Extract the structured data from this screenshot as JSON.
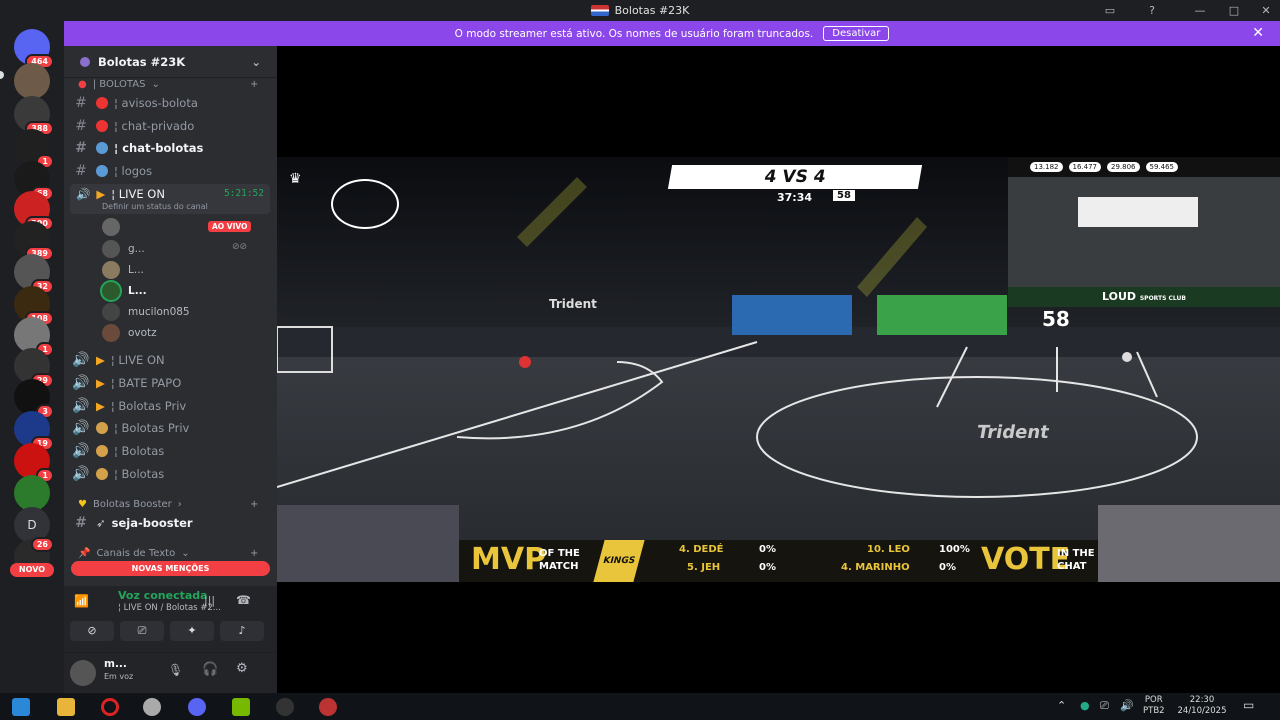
{
  "window": {
    "title": "Bolotas #23K"
  },
  "servers": [
    {
      "badge": "464"
    },
    {
      "badge": ""
    },
    {
      "badge": "388"
    },
    {
      "badge": "1"
    },
    {
      "badge": "68"
    },
    {
      "badge": "290"
    },
    {
      "badge": "389"
    },
    {
      "badge": "32"
    },
    {
      "badge": "108"
    },
    {
      "badge": "1"
    },
    {
      "badge": "29"
    },
    {
      "badge": "3"
    },
    {
      "badge": "19"
    },
    {
      "badge": "1"
    },
    {
      "badge": ""
    },
    {
      "badge": ""
    },
    {
      "badge": "26"
    }
  ],
  "server_d_label": "D",
  "novo_label": "NOVO",
  "banner": {
    "text": "O modo streamer está ativo. Os nomes de usuário foram truncados.",
    "button": "Desativar"
  },
  "guild": {
    "name": "Bolotas #23K"
  },
  "category_bolotas": "| BOLOTAS",
  "channels": [
    {
      "name": "¦ avisos-bolota"
    },
    {
      "name": "¦ chat-privado"
    },
    {
      "name": "¦ chat-bolotas"
    },
    {
      "name": "¦ logos"
    }
  ],
  "live_channel": {
    "name": "¦ LIVE ON",
    "timer": "5:21:52",
    "status": "Definir um status do canal"
  },
  "live_badge": "AO VIVO",
  "voice_users": [
    {
      "name": ""
    },
    {
      "name": "g..."
    },
    {
      "name": "L..."
    },
    {
      "name": "L..."
    },
    {
      "name": "mucilon085"
    },
    {
      "name": "ovotz"
    }
  ],
  "voice_channels": [
    {
      "name": "¦ LIVE ON"
    },
    {
      "name": "¦ BATE PAPO"
    },
    {
      "name": "¦ Bolotas Priv"
    },
    {
      "name": "¦ Bolotas Priv"
    },
    {
      "name": "¦ Bolotas"
    },
    {
      "name": "¦ Bolotas"
    }
  ],
  "category_booster": "Bolotas Booster",
  "booster_channel": "seja-booster",
  "category_text": "Canais de Texto",
  "mentions_label": "NOVAS MENÇÕES",
  "voice": {
    "status": "Voz conectada",
    "channel": "¦ LIVE ON / Bolotas #2..."
  },
  "user": {
    "name": "m...",
    "status": "Em voz"
  },
  "stream": {
    "score": "4 VS 4",
    "clock": "37:34",
    "timer": "58",
    "stats": [
      "13.182",
      "16.477",
      "29.806",
      "59.465"
    ],
    "brand": "LOUD",
    "brand_sub": "SPORTS CLUB",
    "banner_58": "58",
    "sponsor": "Trident",
    "mvp": "MVP",
    "of_the_match": "OF THE MATCH",
    "kings": "KINGS",
    "votes": [
      {
        "name": "4. DEDÉ",
        "pct": "0%"
      },
      {
        "name": "5. JEH",
        "pct": "0%"
      },
      {
        "name": "10. LEO",
        "pct": "100%"
      },
      {
        "name": "4. MARINHO",
        "pct": "0%"
      }
    ],
    "vote": "VOTE",
    "in_the_chat": "IN THE CHAT"
  },
  "taskbar": {
    "lang": "POR",
    "layout": "PTB2",
    "time": "22:30",
    "date": "24/10/2025"
  },
  "colors": {
    "accent": "#8c47ea",
    "danger": "#f23f43",
    "online": "#23a55a"
  }
}
